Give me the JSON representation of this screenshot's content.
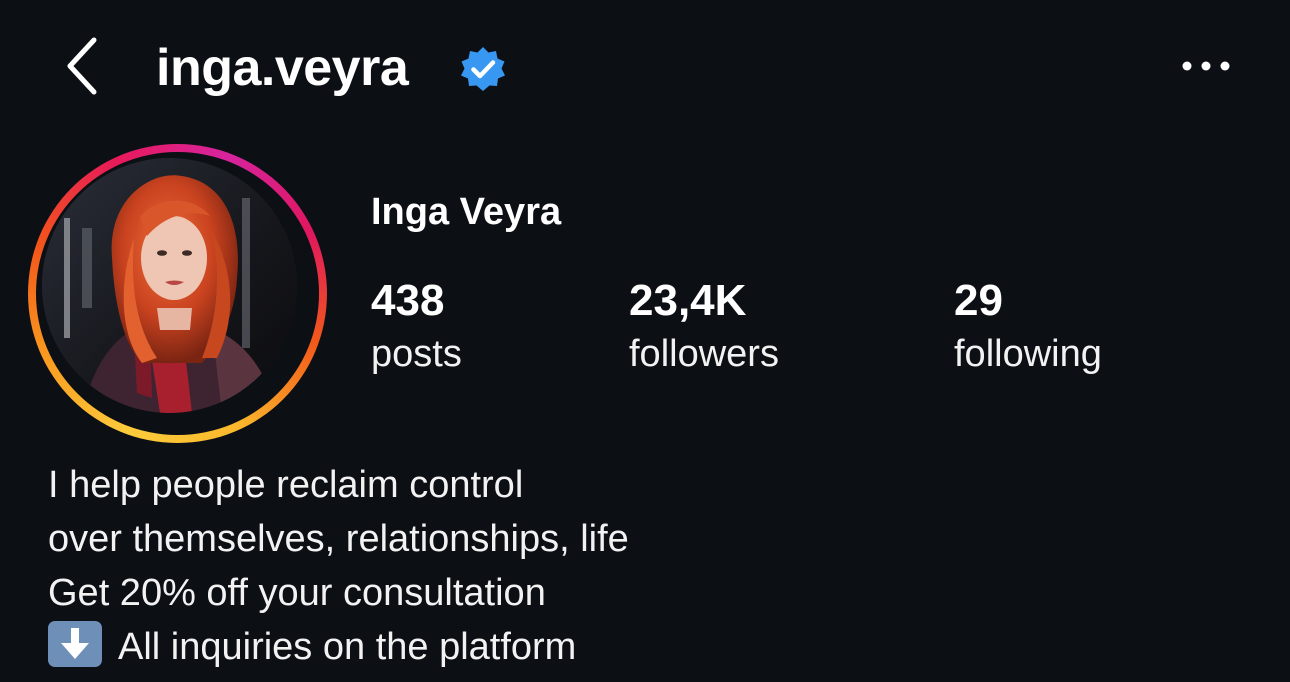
{
  "header": {
    "back_icon": "chevron-left-icon",
    "username": "inga.veyra",
    "verified_icon": "verified-badge-icon",
    "verified_color": "#3897f0",
    "more_icon": "more-horizontal-icon"
  },
  "profile": {
    "display_name": "Inga Veyra",
    "avatar_ring_colors": [
      "#fccc3c",
      "#f2541b",
      "#d6249f"
    ]
  },
  "stats": [
    {
      "value": "438",
      "label": "posts"
    },
    {
      "value": "23,4K",
      "label": "followers"
    },
    {
      "value": "29",
      "label": "following"
    }
  ],
  "bio": {
    "lines": [
      "I help people reclaim control",
      "over themselves, relationships, life",
      "Get 20% off your consultation"
    ],
    "last_line_icon": "down-arrow-emoji-icon",
    "last_line_text": "All inquiries on the platform"
  }
}
